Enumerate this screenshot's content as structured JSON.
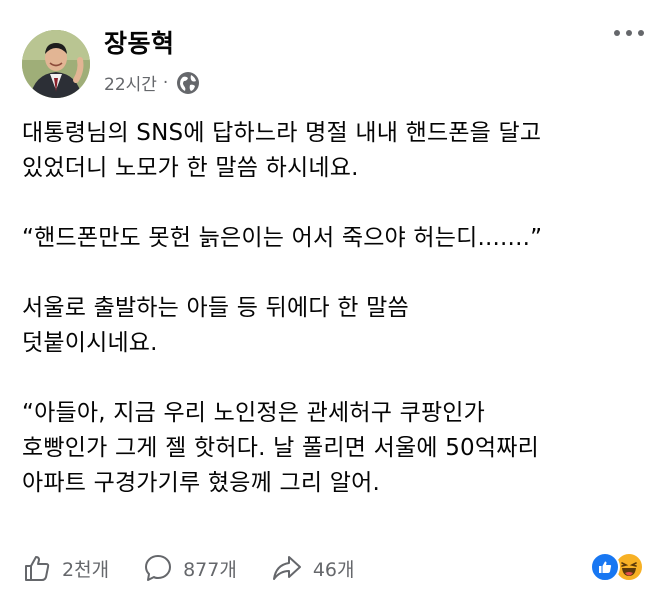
{
  "post": {
    "author": "장동혁",
    "timestamp": "22시간",
    "separator": "·",
    "privacy_icon": "globe-icon",
    "paragraphs": [
      [
        "대통령님의 SNS에 답하느라 명절 내내 핸드폰을 달고",
        "있었더니 노모가 한 말씀 하시네요."
      ],
      [
        "“핸드폰만도 못헌 늙은이는 어서 죽으야 허는디.......”"
      ],
      [
        "서울로 출발하는 아들 등 뒤에다 한 말씀",
        "덧붙이시네요."
      ],
      [
        "“아들아, 지금 우리 노인정은 관세허구 쿠팡인가",
        "호빵인가 그게 젤 핫허다. 날 풀리면 서울에 50억짜리",
        "아파트 구경가기루 혔응께 그리 알어."
      ]
    ]
  },
  "footer": {
    "like_count": "2천개",
    "comment_count": "877개",
    "share_count": "46개",
    "reactions": [
      "like-icon",
      "haha-icon"
    ]
  },
  "colors": {
    "text": "#050505",
    "secondary": "#65676b",
    "like_blue": "#1877f2",
    "haha_yellow": "#f7b125"
  }
}
